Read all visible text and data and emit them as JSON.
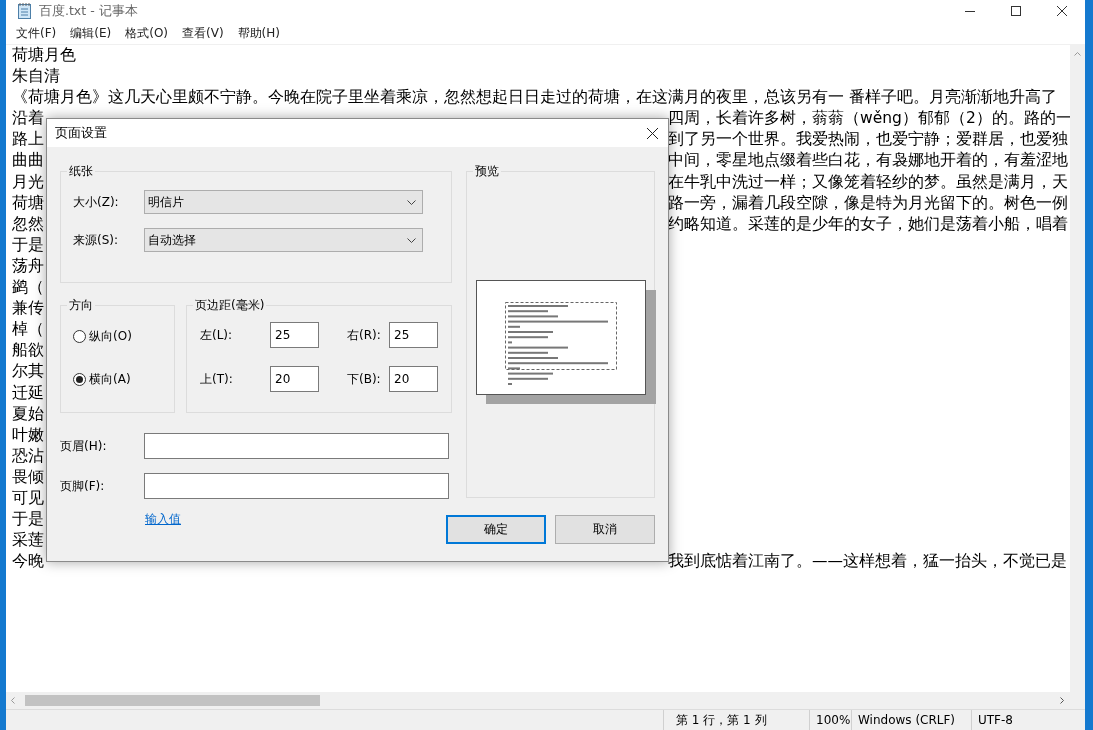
{
  "window": {
    "title": "百度.txt - 记事本"
  },
  "menu": [
    "文件(F)",
    "编辑(E)",
    "格式(O)",
    "查看(V)",
    "帮助(H)"
  ],
  "document": {
    "lines": [
      {
        "kind": "full",
        "text": "荷塘月色"
      },
      {
        "kind": "full",
        "text": "朱自清"
      },
      {
        "kind": "full",
        "text": "《荷塘月色》这几天心里颇不宁静。今晚在院子里坐着乘凉，忽然想起日日走过的荷塘，在这满月的夜里，总该另有一 番样子吧。月亮渐渐地升高了"
      },
      {
        "kind": "split",
        "left": "沿着",
        "right": "四周，长着许多树，蓊蓊（wěng）郁郁（2）的。路的一"
      },
      {
        "kind": "split",
        "left": "路上",
        "right": "到了另一个世界。我爱热闹，也爱宁静；爱群居，也爱独"
      },
      {
        "kind": "split",
        "left": "曲曲",
        "right": "中间，零星地点缀着些白花，有袅娜地开着的，有羞涩地"
      },
      {
        "kind": "split",
        "left": "月光",
        "right": "在牛乳中洗过一样；又像笼着轻纱的梦。虽然是满月，天"
      },
      {
        "kind": "split",
        "left": "荷塘",
        "right": "路一旁，漏着几段空隙，像是特为月光留下的。树色一例"
      },
      {
        "kind": "split",
        "left": "忽然",
        "right": "约略知道。采莲的是少年的女子，她们是荡着小船，唱着"
      },
      {
        "kind": "split",
        "left": "于是"
      },
      {
        "kind": "split",
        "left": "荡舟"
      },
      {
        "kind": "split",
        "left": "鹢（"
      },
      {
        "kind": "split",
        "left": "兼传"
      },
      {
        "kind": "split",
        "left": "棹（"
      },
      {
        "kind": "split",
        "left": "船欲"
      },
      {
        "kind": "split",
        "left": "尔其"
      },
      {
        "kind": "split",
        "left": "迁延"
      },
      {
        "kind": "split",
        "left": "夏始"
      },
      {
        "kind": "split",
        "left": "叶嫩"
      },
      {
        "kind": "split",
        "left": "恐沾"
      },
      {
        "kind": "split",
        "left": "畏倾"
      },
      {
        "kind": "split",
        "left": "可见"
      },
      {
        "kind": "split",
        "left": "于是"
      },
      {
        "kind": "split",
        "left": "采莲"
      },
      {
        "kind": "split",
        "left": "今晚",
        "right": "我到底惦着江南了。——这样想着，猛一抬头，不觉已是"
      }
    ]
  },
  "dialog": {
    "title": "页面设置",
    "paper": {
      "label": "纸张",
      "fields": [
        {
          "label": "大小(Z):",
          "value": "明信片"
        },
        {
          "label": "来源(S):",
          "value": "自动选择"
        }
      ]
    },
    "orientation": {
      "label": "方向",
      "options": [
        {
          "label": "纵向(O)",
          "selected": false
        },
        {
          "label": "横向(A)",
          "selected": true
        }
      ]
    },
    "margins": {
      "label": "页边距(毫米)",
      "fields": [
        {
          "label": "左(L):",
          "value": "25"
        },
        {
          "label": "右(R):",
          "value": "25"
        },
        {
          "label": "上(T):",
          "value": "20"
        },
        {
          "label": "下(B):",
          "value": "20"
        }
      ]
    },
    "header": {
      "label": "页眉(H):"
    },
    "footer": {
      "label": "页脚(F):"
    },
    "link": "输入值",
    "preview": {
      "label": "预览"
    },
    "buttons": [
      {
        "label": "确定",
        "default": true
      },
      {
        "label": "取消",
        "default": false
      }
    ]
  },
  "status_bar": [
    "第 1 行，第 1 列",
    "100%",
    "Windows (CRLF)",
    "UTF-8"
  ]
}
